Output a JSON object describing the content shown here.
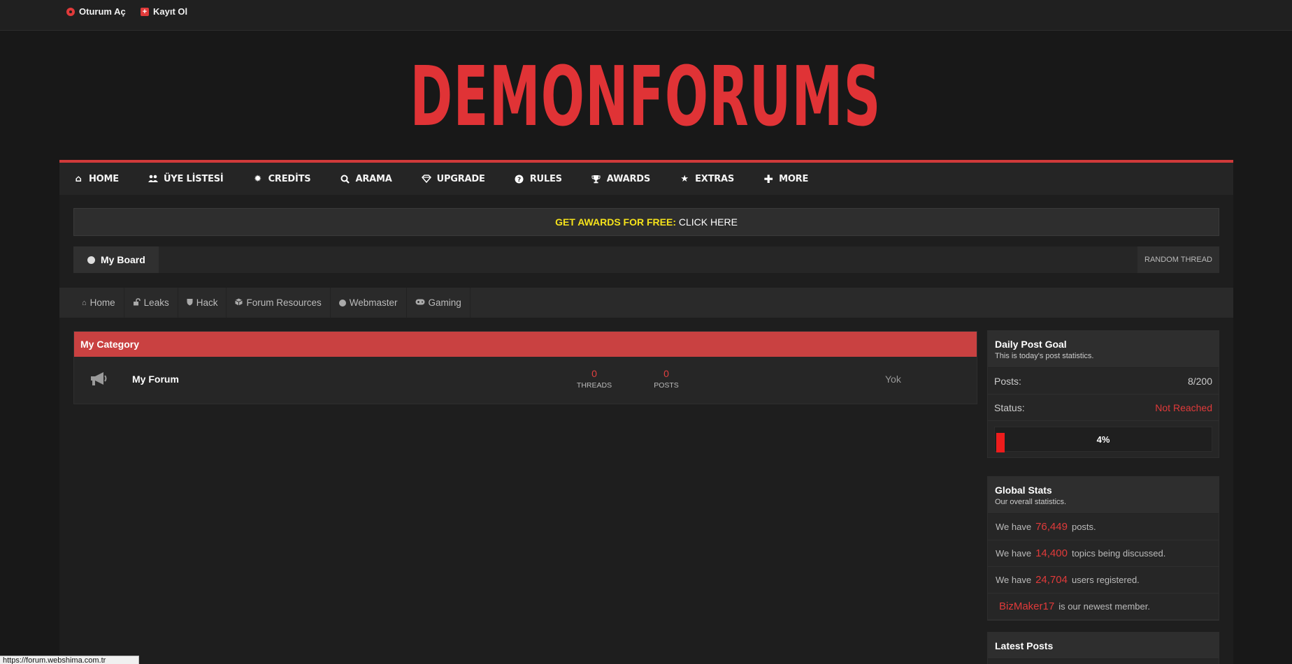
{
  "topbar": {
    "login_label": "Oturum Aç",
    "register_label": "Kayıt Ol"
  },
  "logo": {
    "text": "DEMONFORUMS"
  },
  "mainnav": {
    "items": [
      {
        "label": "HOME",
        "icon": "home-icon"
      },
      {
        "label": "ÜYE LİSTESİ",
        "icon": "users-icon"
      },
      {
        "label": "CREDİTS",
        "icon": "gear-icon"
      },
      {
        "label": "ARAMA",
        "icon": "search-icon"
      },
      {
        "label": "UPGRADE",
        "icon": "diamond-icon"
      },
      {
        "label": "RULES",
        "icon": "question-icon"
      },
      {
        "label": "AWARDS",
        "icon": "trophy-icon"
      },
      {
        "label": "EXTRAS",
        "icon": "star-icon"
      },
      {
        "label": "MORE",
        "icon": "plus-icon"
      }
    ]
  },
  "promo": {
    "highlight": "GET AWARDS FOR FREE:",
    "link": "CLICK HERE"
  },
  "board": {
    "tab_label": "My Board",
    "random_label": "RANDOM THREAD"
  },
  "subnav": {
    "items": [
      {
        "label": "Home",
        "icon": "home-icon"
      },
      {
        "label": "Leaks",
        "icon": "unlock-icon"
      },
      {
        "label": "Hack",
        "icon": "shield-icon"
      },
      {
        "label": "Forum Resources",
        "icon": "cube-icon"
      },
      {
        "label": "Webmaster",
        "icon": "globe-icon"
      },
      {
        "label": "Gaming",
        "icon": "gamepad-icon"
      }
    ]
  },
  "category": {
    "title": "My Category",
    "forum": {
      "name": "My Forum",
      "threads": "0",
      "threads_label": "THREADS",
      "posts": "0",
      "posts_label": "POSTS",
      "lastpost": "Yok"
    }
  },
  "daily_goal": {
    "title": "Daily Post Goal",
    "subtitle": "This is today's post statistics.",
    "posts_label": "Posts:",
    "posts_value": "8/200",
    "status_label": "Status:",
    "status_value": "Not Reached",
    "progress_text": "4%",
    "progress_fraction": 0.04,
    "colors": {
      "accent": "#e03a3a",
      "progress": "#ee1c1c"
    }
  },
  "global_stats": {
    "title": "Global Stats",
    "subtitle": "Our overall statistics.",
    "we_have": "We have",
    "posts_count": "76,449",
    "posts_suffix": "posts.",
    "topics_count": "14,400",
    "topics_suffix": "topics being discussed.",
    "users_count": "24,704",
    "users_suffix": "users registered.",
    "newest_member": "BizMaker17",
    "newest_suffix": "is our newest member."
  },
  "latest_posts": {
    "title": "Latest Posts"
  },
  "statusbar": {
    "url": "https://forum.webshima.com.tr"
  }
}
